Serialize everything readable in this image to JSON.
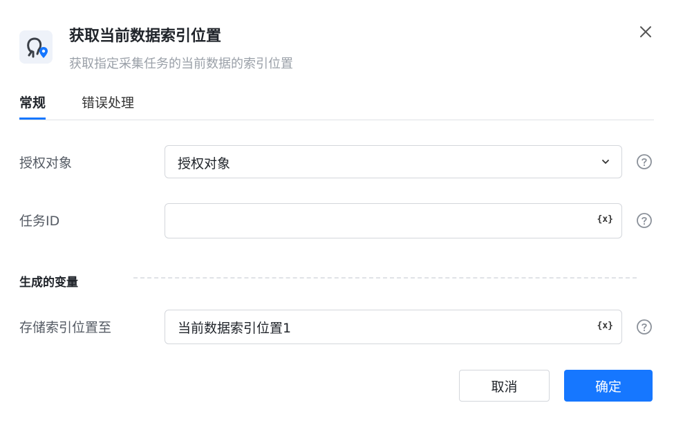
{
  "dialog": {
    "title": "获取当前数据索引位置",
    "subtitle": "获取指定采集任务的当前数据的索引位置",
    "icon": "location-pin-app-icon",
    "accent_color": "#1677ff"
  },
  "tabs": [
    {
      "label": "常规",
      "active": true
    },
    {
      "label": "错误处理",
      "active": false
    }
  ],
  "fields": {
    "auth": {
      "label": "授权对象",
      "value": "授权对象"
    },
    "task_id": {
      "label": "任务ID",
      "value": "",
      "var_button": "{x}"
    },
    "store": {
      "label": "存储索引位置至",
      "value": "当前数据索引位置1",
      "var_button": "{x}"
    }
  },
  "section": {
    "title": "生成的变量"
  },
  "buttons": {
    "cancel": "取消",
    "ok": "确定"
  }
}
